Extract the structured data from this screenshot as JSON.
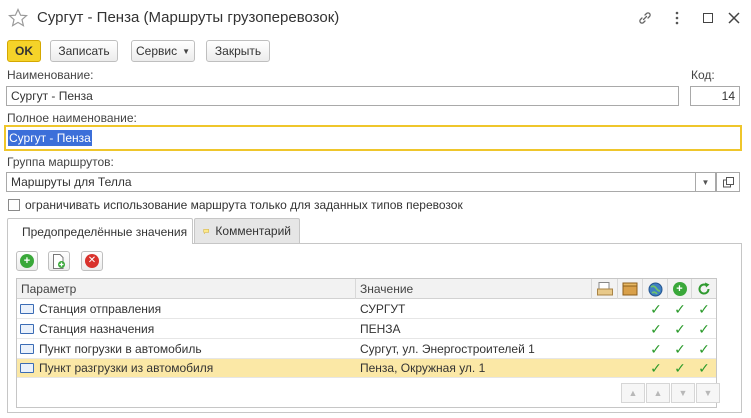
{
  "window": {
    "title": "Сургут - Пенза (Маршруты грузоперевозок)"
  },
  "toolbar": {
    "ok_label": "OK",
    "save_label": "Записать",
    "service_label": "Сервис",
    "close_label": "Закрыть"
  },
  "form": {
    "name_label": "Наименование:",
    "name_value": "Сургут - Пенза",
    "code_label": "Код:",
    "code_value": "14",
    "full_name_label": "Полное наименование:",
    "full_name_value": "Сургут - Пенза",
    "group_label": "Группа маршрутов:",
    "group_value": "Маршруты для Телла",
    "limit_checkbox_label": "ограничивать использование маршрута только для заданных типов перевозок",
    "limit_checked": false
  },
  "tabs": [
    {
      "label": "Предопределённые значения",
      "active": true
    },
    {
      "label": "Комментарий",
      "active": false
    }
  ],
  "grid": {
    "columns": [
      "Параметр",
      "Значение"
    ],
    "rows": [
      {
        "param": "Станция отправления",
        "value": "СУРГУТ",
        "selected": false
      },
      {
        "param": "Станция назначения",
        "value": "ПЕНЗА",
        "selected": false
      },
      {
        "param": "Пункт погрузки в автомобиль",
        "value": "Сургут, ул. Энергостроителей 1",
        "selected": false
      },
      {
        "param": "Пункт разгрузки из автомобиля",
        "value": "Пенза, Окружная ул. 1",
        "selected": true
      }
    ]
  },
  "colors": {
    "accent": "#f5d329",
    "selected_row": "#fbe8a6",
    "check": "#2a9a2a",
    "focus_border": "#efc62b"
  }
}
